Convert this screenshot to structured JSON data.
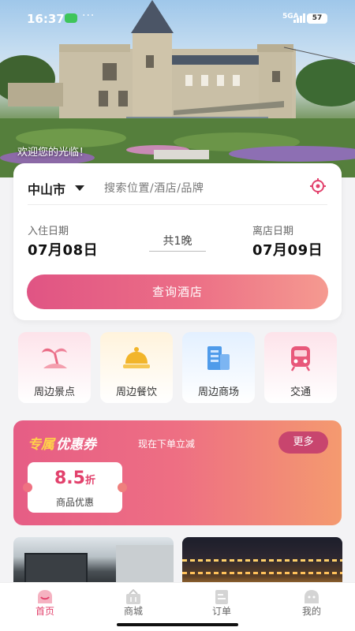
{
  "status_bar": {
    "time": "16:37",
    "dots": "···",
    "network": "5GA",
    "battery": "57"
  },
  "hero": {
    "welcome_text": "欢迎您的光临！"
  },
  "search": {
    "city": "中山市",
    "placeholder": "搜索位置/酒店/品牌",
    "checkin_label": "入住日期",
    "checkin_date": "07月08日",
    "nights": "共1晚",
    "checkout_label": "离店日期",
    "checkout_date": "07月09日",
    "submit_label": "查询酒店"
  },
  "quick_links": [
    {
      "label": "周边景点",
      "icon": "palm-tree-icon",
      "bg": "#fde3ea",
      "color": "#ea6a84"
    },
    {
      "label": "周边餐饮",
      "icon": "food-cloche-icon",
      "bg": "#fff3dc",
      "color": "#f2b52a"
    },
    {
      "label": "周边商场",
      "icon": "building-icon",
      "bg": "#e3f0ff",
      "color": "#4f9bea"
    },
    {
      "label": "交通",
      "icon": "train-icon",
      "bg": "#fde3ea",
      "color": "#e8587a"
    }
  ],
  "coupon": {
    "title_part1": "专属",
    "title_part2": "优惠券",
    "subtitle": "现在下单立减",
    "more_label": "更多",
    "discount_value": "8.5",
    "discount_unit": "折",
    "discount_desc": "商品优惠"
  },
  "tabs": [
    {
      "label": "首页",
      "icon": "home-smile-icon",
      "active": true
    },
    {
      "label": "商城",
      "icon": "shop-basket-icon",
      "active": false
    },
    {
      "label": "订单",
      "icon": "order-list-icon",
      "active": false
    },
    {
      "label": "我的",
      "icon": "profile-icon",
      "active": false
    }
  ],
  "colors": {
    "accent": "#e2416c",
    "accent_gradient_start": "#e05484",
    "accent_gradient_end": "#f59a90"
  }
}
